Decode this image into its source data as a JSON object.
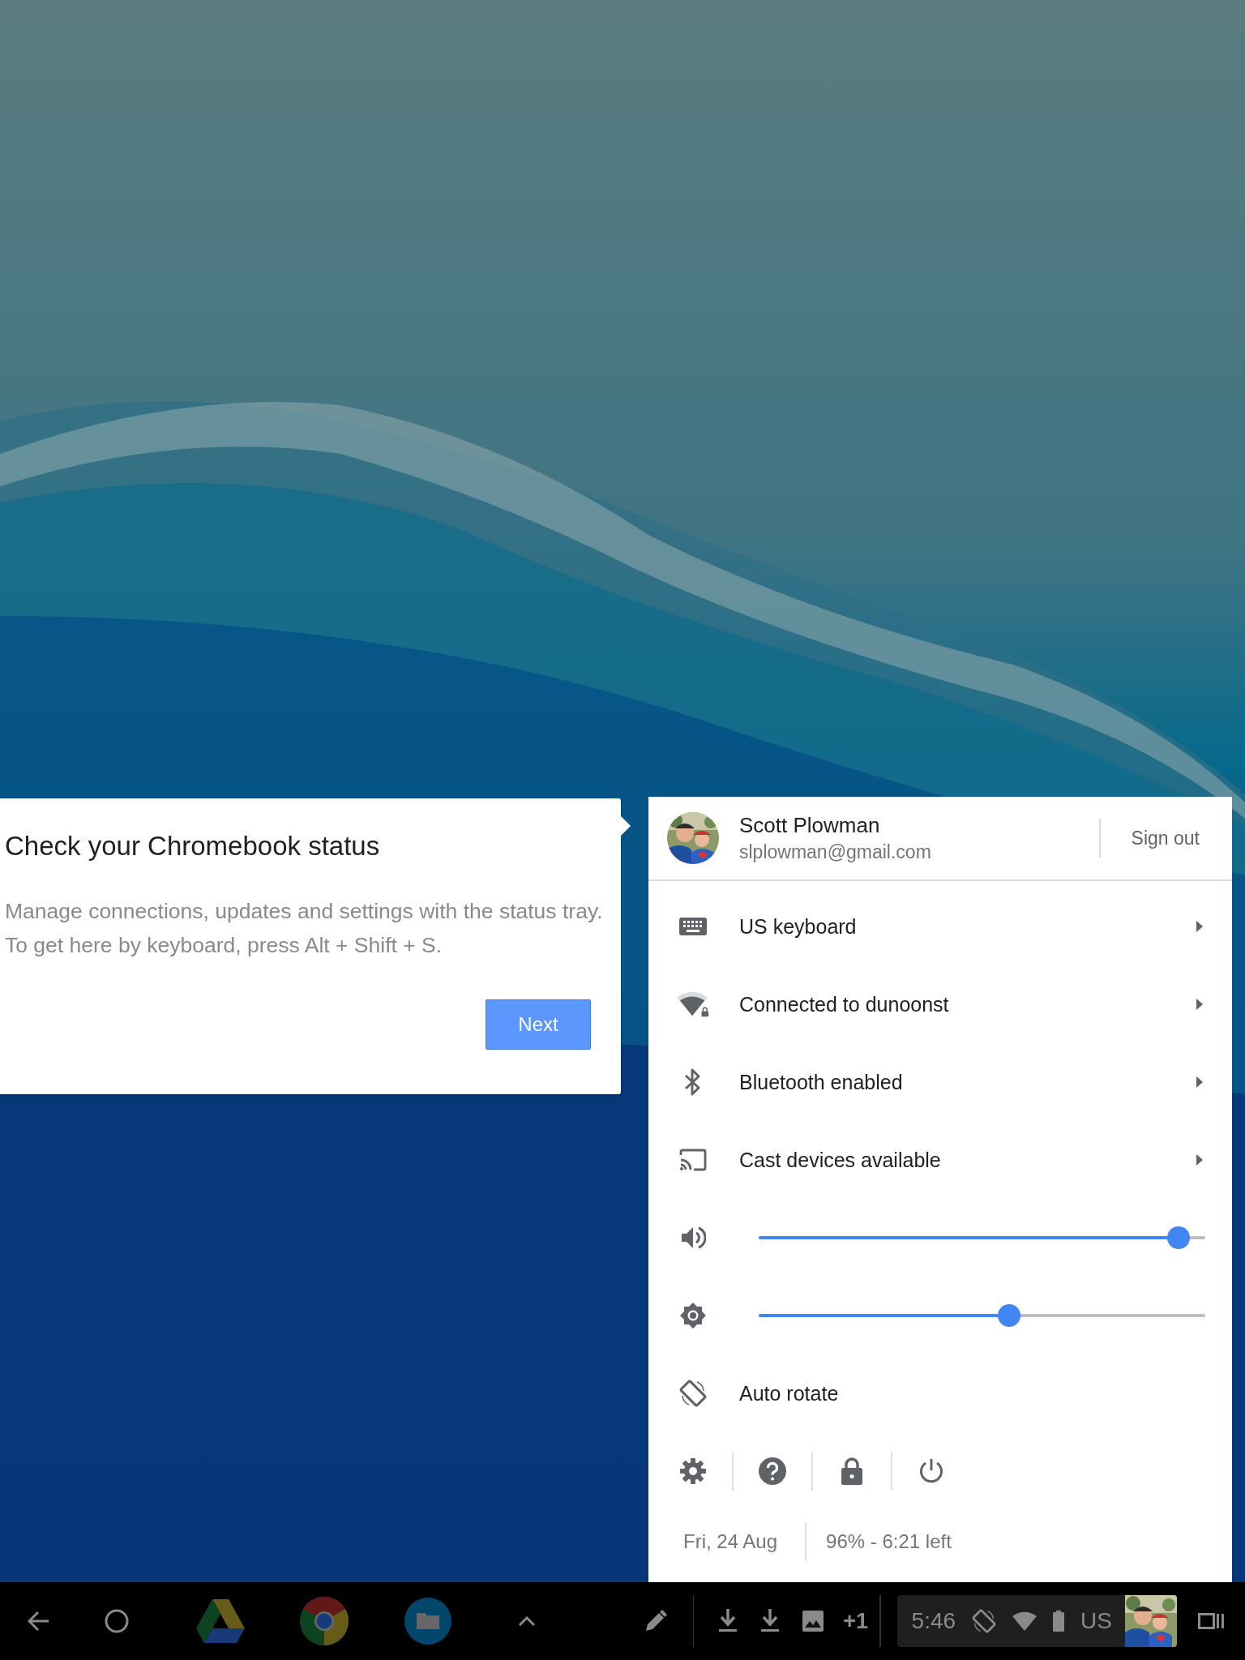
{
  "tutorial_bubble": {
    "title": "Check your Chromebook status",
    "body": "Manage connections, updates and settings with the status tray. To get here by keyboard, press Alt + Shift + S.",
    "button": "Next"
  },
  "status_tray": {
    "user": {
      "name": "Scott Plowman",
      "email": "slplowman@gmail.com"
    },
    "sign_out": "Sign out",
    "rows": [
      {
        "kind": "submenu",
        "label": "US keyboard"
      },
      {
        "kind": "submenu",
        "label": "Connected to dunoonst"
      },
      {
        "kind": "submenu",
        "label": "Bluetooth enabled"
      },
      {
        "kind": "submenu",
        "label": "Cast devices available"
      },
      {
        "kind": "slider",
        "level": 0.94
      },
      {
        "kind": "slider",
        "level": 0.56
      },
      {
        "kind": "plain",
        "label": "Auto rotate"
      }
    ],
    "date": "Fri, 24 Aug",
    "battery": "96% - 6:21 left"
  },
  "shelf": {
    "notification_count": "+1",
    "time": "5:46",
    "input_method": "US"
  }
}
